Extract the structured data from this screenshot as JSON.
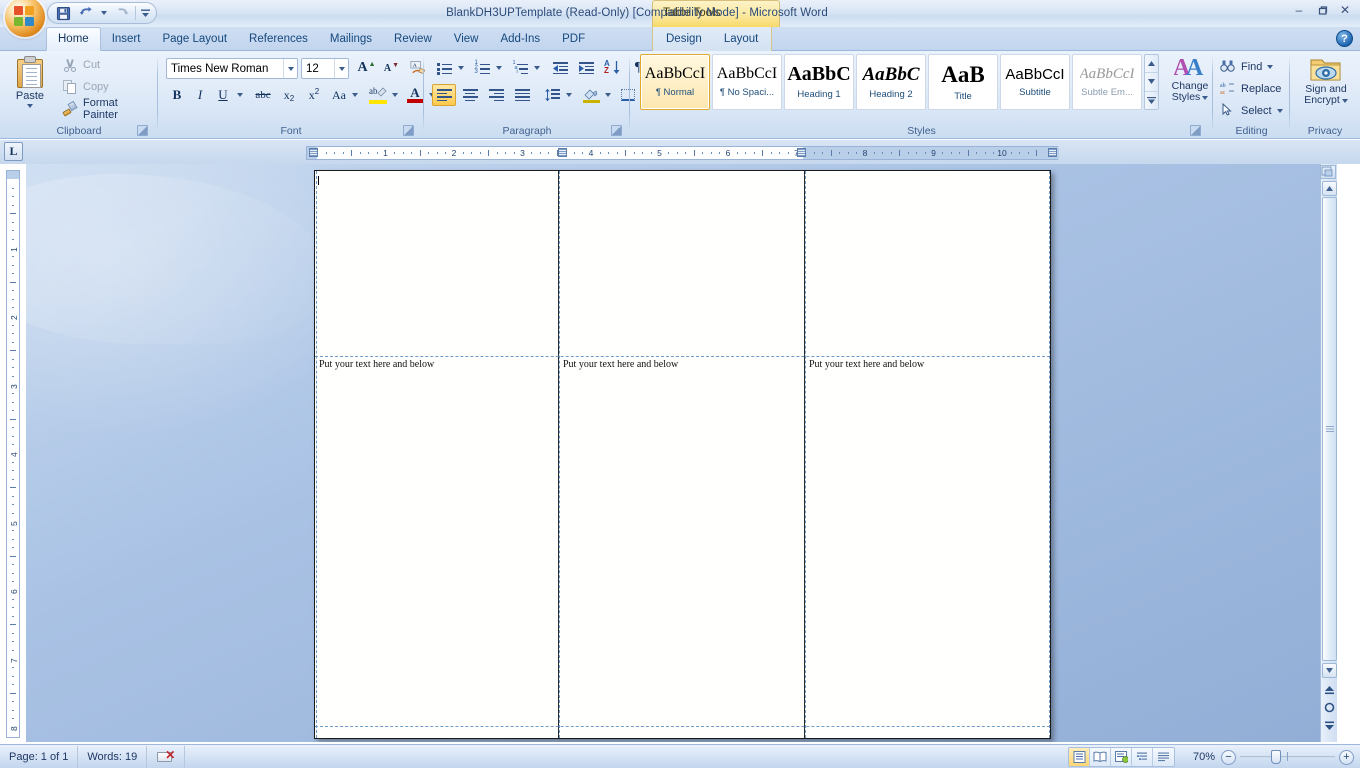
{
  "window": {
    "title": "BlankDH3UPTemplate (Read-Only) [Compatibility Mode] - Microsoft Word",
    "contextual_tab_header": "Table Tools",
    "minimize": "–",
    "restore": "❐",
    "close": "✕",
    "help": "?"
  },
  "quick_access": {
    "save": "save-icon",
    "undo": "undo-icon",
    "undo_dropdown": "chevron-down-icon",
    "redo": "redo-icon",
    "customize": "chevron-down-icon"
  },
  "tabs": [
    {
      "label": "Home",
      "active": true
    },
    {
      "label": "Insert",
      "active": false
    },
    {
      "label": "Page Layout",
      "active": false
    },
    {
      "label": "References",
      "active": false
    },
    {
      "label": "Mailings",
      "active": false
    },
    {
      "label": "Review",
      "active": false
    },
    {
      "label": "View",
      "active": false
    },
    {
      "label": "Add-Ins",
      "active": false
    },
    {
      "label": "PDF",
      "active": false
    }
  ],
  "contextual_tabs": [
    {
      "label": "Design"
    },
    {
      "label": "Layout"
    }
  ],
  "ribbon": {
    "clipboard": {
      "label": "Clipboard",
      "paste": "Paste",
      "cut": "Cut",
      "copy": "Copy",
      "format_painter": "Format Painter"
    },
    "font": {
      "label": "Font",
      "font_name": "Times New Roman",
      "font_size": "12",
      "grow_font": "A",
      "shrink_font": "A",
      "clear_formatting": "Aa",
      "bold": "B",
      "italic": "I",
      "underline": "U",
      "strikethrough": "abc",
      "subscript": "x",
      "superscript": "x",
      "change_case": "Aa",
      "highlight": "ab",
      "font_color": "A"
    },
    "paragraph": {
      "label": "Paragraph",
      "bullets": "bullets-icon",
      "numbering": "numbering-icon",
      "multilevel": "multilevel-list-icon",
      "decrease_indent": "decrease-indent-icon",
      "increase_indent": "increase-indent-icon",
      "sort": "sort-icon",
      "show_marks": "¶",
      "align_left": "align-left-icon",
      "align_center": "align-center-icon",
      "align_right": "align-right-icon",
      "justify": "justify-icon",
      "line_spacing": "line-spacing-icon",
      "shading": "shading-icon",
      "borders": "borders-icon"
    },
    "styles": {
      "label": "Styles",
      "items": [
        {
          "sample": "AaBbCcI",
          "name": "¶ Normal",
          "selected": true
        },
        {
          "sample": "AaBbCcI",
          "name": "¶ No Spaci...",
          "selected": false
        },
        {
          "sample": "AaBbC",
          "name": "Heading 1",
          "selected": false
        },
        {
          "sample": "AaBbC",
          "name": "Heading 2",
          "selected": false
        },
        {
          "sample": "AaB",
          "name": "Title",
          "selected": false
        },
        {
          "sample": "AaBbCcI",
          "name": "Subtitle",
          "selected": false
        },
        {
          "sample": "AaBbCcI",
          "name": "Subtle Em...",
          "selected": false
        }
      ],
      "change_styles_line1": "Change",
      "change_styles_line2": "Styles"
    },
    "editing": {
      "label": "Editing",
      "find": "Find",
      "replace": "Replace",
      "select": "Select"
    },
    "privacy": {
      "label": "Privacy",
      "sign_encrypt_line1": "Sign and",
      "sign_encrypt_line2": "Encrypt"
    }
  },
  "rulers": {
    "corner_tab_stop": "L",
    "horizontal_numbers": [
      "1",
      "2",
      "3",
      "4",
      "5",
      "6",
      "7",
      "8",
      "9",
      "10"
    ],
    "vertical_numbers": [
      "1",
      "2",
      "3",
      "4",
      "5",
      "6",
      "7"
    ]
  },
  "document": {
    "columns": [
      {
        "text": "Put your text here and below"
      },
      {
        "text": "Put your text here and below"
      },
      {
        "text": "Put your text here and below"
      }
    ]
  },
  "status_bar": {
    "page": "Page: 1 of 1",
    "words": "Words: 19",
    "proofing": "proofing-errors-icon",
    "views": [
      {
        "name": "print-layout-view",
        "selected": true
      },
      {
        "name": "full-screen-reading-view",
        "selected": false
      },
      {
        "name": "web-layout-view",
        "selected": false
      },
      {
        "name": "outline-view",
        "selected": false
      },
      {
        "name": "draft-view",
        "selected": false
      }
    ],
    "zoom": "70%",
    "zoom_out": "−",
    "zoom_in": "+"
  },
  "colors": {
    "accent": "#1f3864",
    "ribbon_bg": "#e2ecf8",
    "contextual_yellow": "#fbe79a",
    "workspace_blue": "#a9c2e4",
    "selection_gold": "#fdc84b"
  }
}
